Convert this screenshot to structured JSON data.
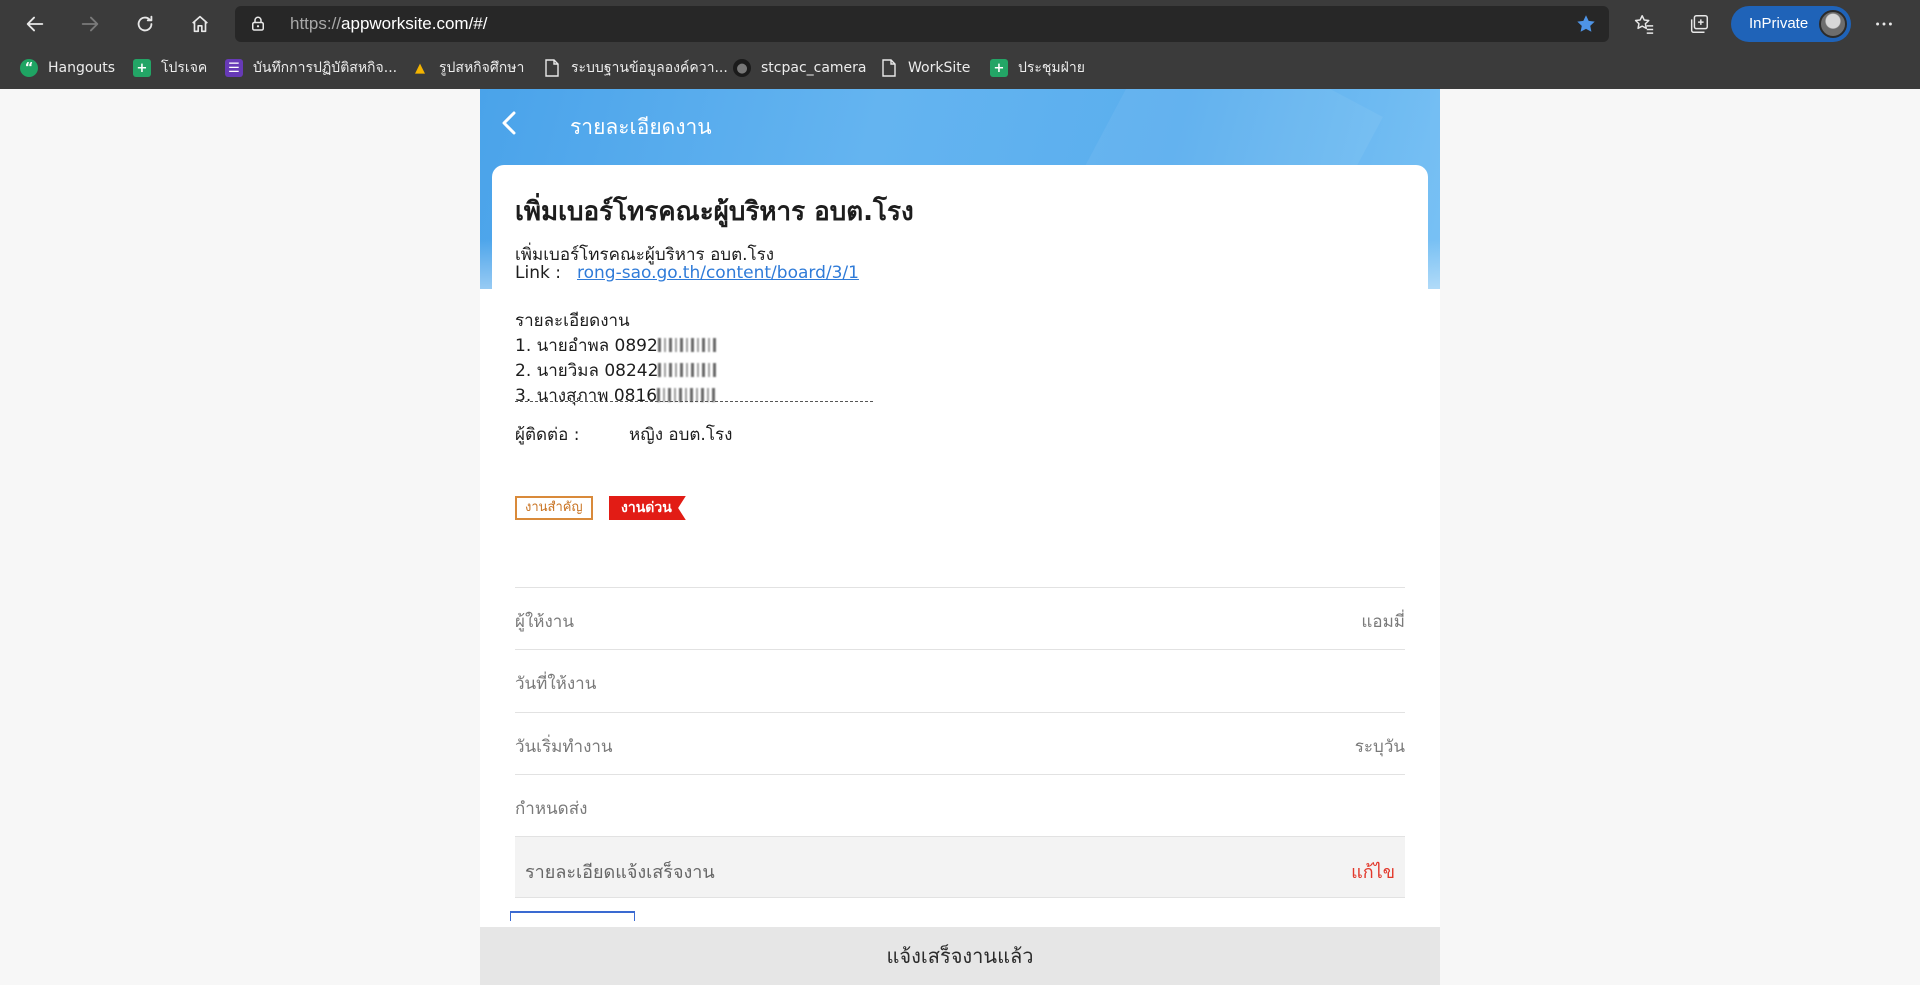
{
  "browser": {
    "url_protocol": "https://",
    "url_rest": "appworksite.com/#/",
    "inprivate_label": "InPrivate",
    "bookmarks": [
      {
        "label": "Hangouts",
        "icon": "hangouts-icon",
        "color": "#1fa463",
        "glyph": "“"
      },
      {
        "label": "โปรเจค",
        "icon": "sheets-icon",
        "color": "#23a566",
        "glyph": "+"
      },
      {
        "label": "บันทึกการปฏิบัติสหกิจ...",
        "icon": "forms-icon",
        "color": "#673ab7",
        "glyph": "☰"
      },
      {
        "label": "รูปสหกิจศึกษา",
        "icon": "drive-icon",
        "color": "#f4b400",
        "glyph": "▲"
      },
      {
        "label": "ระบบฐานข้อมูลองค์ควา...",
        "icon": "page-icon",
        "color": "transparent",
        "glyph": ""
      },
      {
        "label": "stcpac_camera",
        "icon": "github-icon",
        "color": "#1b1b1b",
        "glyph": "●"
      },
      {
        "label": "WorkSite",
        "icon": "page-icon",
        "color": "transparent",
        "glyph": ""
      },
      {
        "label": "ประชุมฝ่าย",
        "icon": "sheets-icon",
        "color": "#23a566",
        "glyph": "+"
      }
    ]
  },
  "header": {
    "title": "รายละเอียดงาน"
  },
  "job": {
    "title": "เพิ่มเบอร์โทรคณะผู้บริหาร อบต.โรง",
    "subtitle": "เพิ่มเบอร์โทรคณะผู้บริหาร อบต.โรง",
    "link_label": "Link :",
    "link_url": "rong-sao.go.th/content/board/3/1",
    "details_heading": "รายละเอียดงาน",
    "details": [
      "1. นายอำพล 0892",
      "2. นายวิมล 08242",
      "3. นางสุภาพ 0816"
    ],
    "contact_label": "ผู้ติดต่อ :",
    "contact_value": "หญิง อบต.โรง",
    "tag_important": "งานสำคัญ",
    "tag_urgent": "งานด่วน"
  },
  "fields": {
    "assigner_label": "ผู้ให้งาน",
    "assigner_value": "แอมมี่",
    "assigned_date_label": "วันที่ให้งาน",
    "assigned_date_value": "",
    "start_date_label": "วันเริ่มทำงาน",
    "start_date_value": "ระบุวัน",
    "due_label": "กำหนดส่ง",
    "due_value": "",
    "completion_label": "รายละเอียดแจ้งเสร็จงาน",
    "completion_edit": "แก้ไข"
  },
  "submit_label": "แจ้งเสร็จงานแล้ว",
  "colors": {
    "header_blue": "#4aa3ea",
    "urgent_red": "#e21c15",
    "important_orange": "#d98a3a",
    "edit_red": "#e2382b",
    "link_blue": "#2f7bd8"
  }
}
